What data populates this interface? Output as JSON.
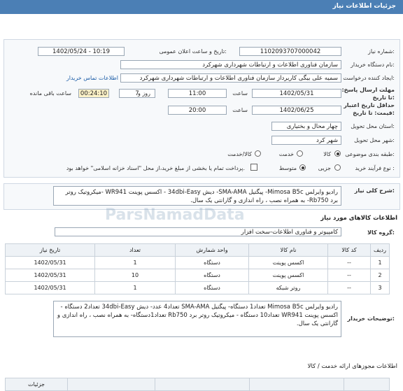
{
  "header": {
    "title": "جزئیات اطلاعات نیاز"
  },
  "form": {
    "need_number_label": "شماره نیاز:",
    "need_number": "1102093707000042",
    "announce_label": "تاریخ و ساعت اعلان عمومی:",
    "announce_value": "1402/05/24 - 10:19",
    "buyer_label": "نام دستگاه خریدار:",
    "buyer_value": "سازمان فناوری اطلاعات و ارتباطات شهرداری شهرکرد",
    "creator_label": "ایجاد کننده درخواست:",
    "creator_value": "سمیه علی بیگی کاربرداز سازمان فناوری اطلاعات و ارتباطات شهرداری شهرکرد",
    "contact_link": "اطلاعات تماس خریدار",
    "deadline_label": "مهلت ارسال پاسخ: تا تاریخ:",
    "deadline_date": "1402/05/31",
    "time_label": "ساعت",
    "deadline_time": "11:00",
    "days_value": "7",
    "days_label": "روز و",
    "remaining_value": "00:24:10",
    "remaining_label": "ساعت باقی مانده",
    "validity_label": "حداقل تاریخ اعتبار قیمت: تا تاریخ:",
    "validity_date": "1402/06/25",
    "validity_time": "20:00",
    "province_label": "استان محل تحویل:",
    "province_value": "چهار محال و بختیاری",
    "city_label": "شهر محل تحویل:",
    "city_value": "شهر کرد",
    "category_label": "طبقه بندی موضوعی:",
    "category_options": [
      "کالا",
      "خدمت",
      "کالا/خدمت"
    ],
    "purchase_label": "نوع فرآیند خرید :",
    "purchase_options": [
      "جزیی",
      "متوسط"
    ],
    "payment_note": "پرداخت تمام یا بخشی از مبلغ خرید،از محل \"اسناد خزانه اسلامی\" خواهد بود."
  },
  "summary": {
    "label": "شرح کلی نیاز:",
    "text": "رادیو وایرلس Mimosa B5c- پیگتیل SMA-AMA- دیش 34dbi-Easy - اکسس پوینت WR941 -میکروتیک روتر برد Rb750- به همراه نصب ، راه اندازی و گارانتی یک سال."
  },
  "goods": {
    "section_title": "اطلاعات کالاهای مورد نیاز",
    "group_label": "گروه کالا:",
    "group_value": "کامپیوتر و فناوری اطلاعات-سخت افزار",
    "columns": [
      "ردیف",
      "کد کالا",
      "نام کالا",
      "واحد شمارش",
      "تعداد",
      "تاریخ نیاز"
    ],
    "rows": [
      [
        "1",
        "--",
        "اکسس پوینت",
        "دستگاه",
        "1",
        "1402/05/31"
      ],
      [
        "2",
        "--",
        "اکسس پوینت",
        "دستگاه",
        "10",
        "1402/05/31"
      ],
      [
        "3",
        "--",
        "روتر شبکه",
        "دستگاه",
        "1",
        "1402/05/31"
      ]
    ]
  },
  "buyer_notes": {
    "label": "توضیحات خریدار:",
    "text": "رادیو وایرلس Mimosa B5c تعداد1 دستگاه- پیگتیل SMA-AMA تعداد4 عدد- دیش 34dbi-Easy تعداد2 دستگاه - اکسس پوینت WR941 تعداد10 دستگاه - میکروتیک روتر برد Rb750 تعداد1دستگاه- به همراه نصب ، راه اندازی و گارانتی یک سال."
  },
  "licenses": {
    "title": "اطلاعات مجوزهای ارائه خدمت / کالا",
    "columns": [
      "جزئیات"
    ]
  },
  "watermark": "ParsNamadData"
}
